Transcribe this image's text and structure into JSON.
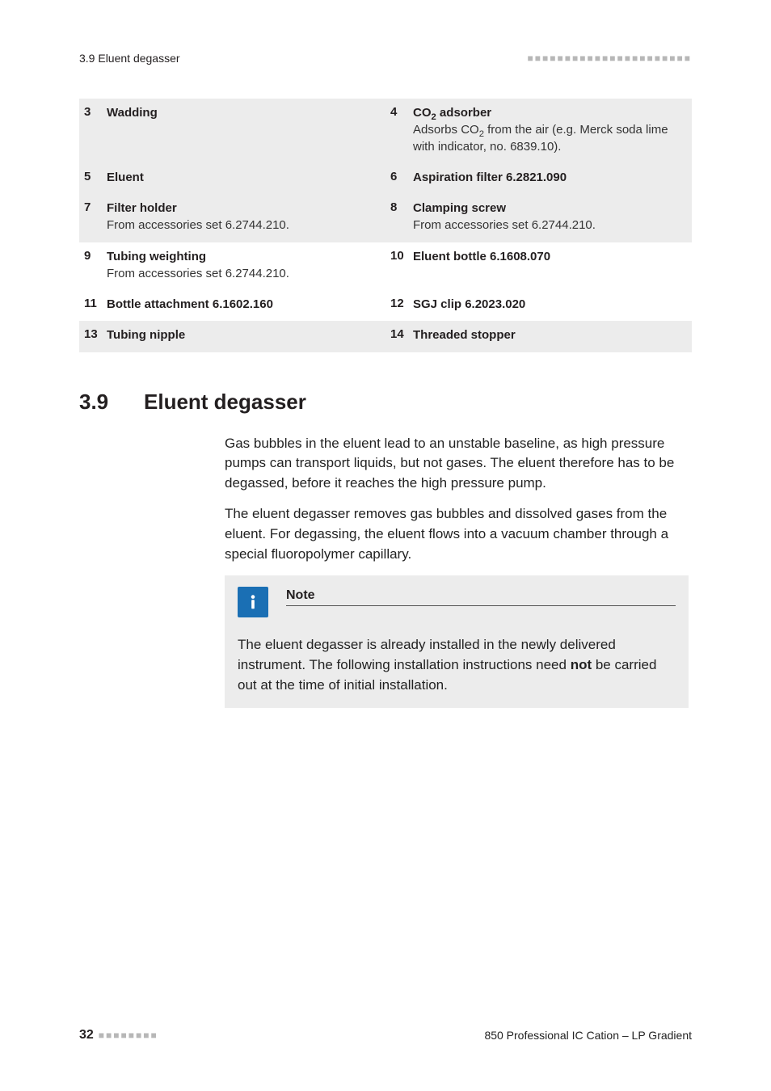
{
  "header": {
    "left": "3.9 Eluent degasser",
    "right_dots": "■■■■■■■■■■■■■■■■■■■■■■"
  },
  "legend": [
    {
      "left": {
        "num": "3",
        "title": "Wadding",
        "desc": ""
      },
      "right": {
        "num": "4",
        "title_html": "CO<sub>2</sub> adsorber",
        "desc_html": "Adsorbs CO<sub>2</sub> from the air (e.g. Merck soda lime with indicator, no. 6839.10)."
      },
      "shaded": true
    },
    {
      "left": {
        "num": "5",
        "title": "Eluent",
        "desc": ""
      },
      "right": {
        "num": "6",
        "title": "Aspiration filter 6.2821.090",
        "desc": ""
      },
      "shaded": true
    },
    {
      "left": {
        "num": "7",
        "title": "Filter holder",
        "desc": "From accessories set 6.2744.210."
      },
      "right": {
        "num": "8",
        "title": "Clamping screw",
        "desc": "From accessories set 6.2744.210."
      },
      "shaded": true
    },
    {
      "left": {
        "num": "9",
        "title": "Tubing weighting",
        "desc": "From accessories set 6.2744.210."
      },
      "right": {
        "num": "10",
        "title": "Eluent bottle 6.1608.070",
        "desc": ""
      },
      "shaded": false
    },
    {
      "left": {
        "num": "11",
        "title": "Bottle attachment 6.1602.160",
        "desc": ""
      },
      "right": {
        "num": "12",
        "title": "SGJ clip 6.2023.020",
        "desc": ""
      },
      "shaded": false
    },
    {
      "left": {
        "num": "13",
        "title": "Tubing nipple",
        "desc": ""
      },
      "right": {
        "num": "14",
        "title": "Threaded stopper",
        "desc": ""
      },
      "shaded": true
    }
  ],
  "section": {
    "num": "3.9",
    "title": "Eluent degasser"
  },
  "body": {
    "p1": "Gas bubbles in the eluent lead to an unstable baseline, as high pressure pumps can transport liquids, but not gases. The eluent therefore has to be degassed, before it reaches the high pressure pump.",
    "p2": "The eluent degasser removes gas bubbles and dissolved gases from the eluent. For degassing, the eluent flows into a vacuum chamber through a special fluoropolymer capillary."
  },
  "note": {
    "label": "Note",
    "text_html": "The eluent degasser is already installed in the newly delivered instrument. The following installation instructions need <b>not</b> be carried out at the time of initial installation."
  },
  "footer": {
    "page": "32",
    "dots": "■■■■■■■■",
    "right": "850 Professional IC Cation – LP Gradient"
  }
}
